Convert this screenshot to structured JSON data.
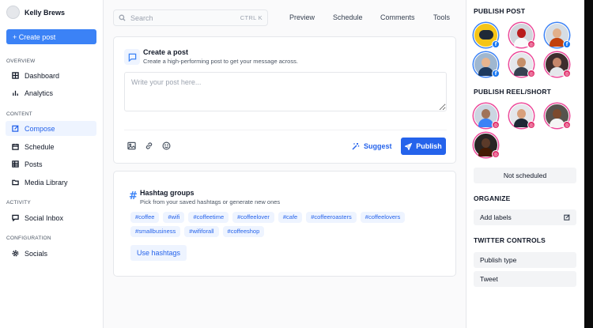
{
  "app": {
    "user_name": "Kelly Brews"
  },
  "sidebar": {
    "create_label": "+ Create post",
    "sections": {
      "overview": "OVERVIEW",
      "content": "CONTENT",
      "activity": "ACTIVITY",
      "configuration": "CONFIGURATION"
    },
    "items": {
      "dashboard": "Dashboard",
      "analytics": "Analytics",
      "compose": "Compose",
      "schedule": "Schedule",
      "posts": "Posts",
      "media_library": "Media Library",
      "social_inbox": "Social Inbox",
      "socials": "Socials"
    },
    "active": "compose"
  },
  "topbar": {
    "search_placeholder": "Search",
    "search_shortcut": "CTRL K",
    "tabs": [
      "Preview",
      "Schedule",
      "Comments",
      "Tools"
    ]
  },
  "composer": {
    "title": "Create a post",
    "subtitle": "Create a high-performing post to get your message across.",
    "textarea_placeholder": "Write your post here...",
    "suggest_label": "Suggest",
    "publish_label": "Publish",
    "tools": [
      "image-icon",
      "link-icon",
      "emoji-icon"
    ]
  },
  "hashtags": {
    "title": "Hashtag groups",
    "subtitle": "Pick from your saved hashtags or generate new ones",
    "tags": [
      "#coffee",
      "#wifi",
      "#coffeetime",
      "#coffeelover",
      "#cafe",
      "#coffeeroasters",
      "#coffeelovers",
      "#smallbusiness",
      "#wififorall",
      "#coffeeshop"
    ],
    "button_label": "Use hashtags"
  },
  "right_panel": {
    "publish_post_title": "PUBLISH POST",
    "publish_reel_title": "PUBLISH REEL/SHORT",
    "schedule_status": "Not scheduled",
    "organize_title": "ORGANIZE",
    "add_labels": "Add labels",
    "twitter_title": "TWITTER CONTROLS",
    "publish_type": "Publish type",
    "tweet": "Tweet",
    "post_accounts": [
      {
        "network": "facebook",
        "badge": "f"
      },
      {
        "network": "instagram",
        "badge": "◎"
      },
      {
        "network": "facebook",
        "badge": "f"
      },
      {
        "network": "facebook",
        "badge": "f"
      },
      {
        "network": "instagram",
        "badge": "◎"
      },
      {
        "network": "instagram",
        "badge": "◎"
      }
    ],
    "reel_accounts": [
      {
        "network": "instagram",
        "badge": "◎"
      },
      {
        "network": "instagram",
        "badge": "◎"
      },
      {
        "network": "instagram",
        "badge": "◎"
      },
      {
        "network": "instagram",
        "badge": "◎"
      }
    ]
  },
  "colors": {
    "accent": "#2563eb",
    "accent_light": "#eef4ff",
    "facebook": "#1877f2",
    "instagram": "#e1306c"
  }
}
